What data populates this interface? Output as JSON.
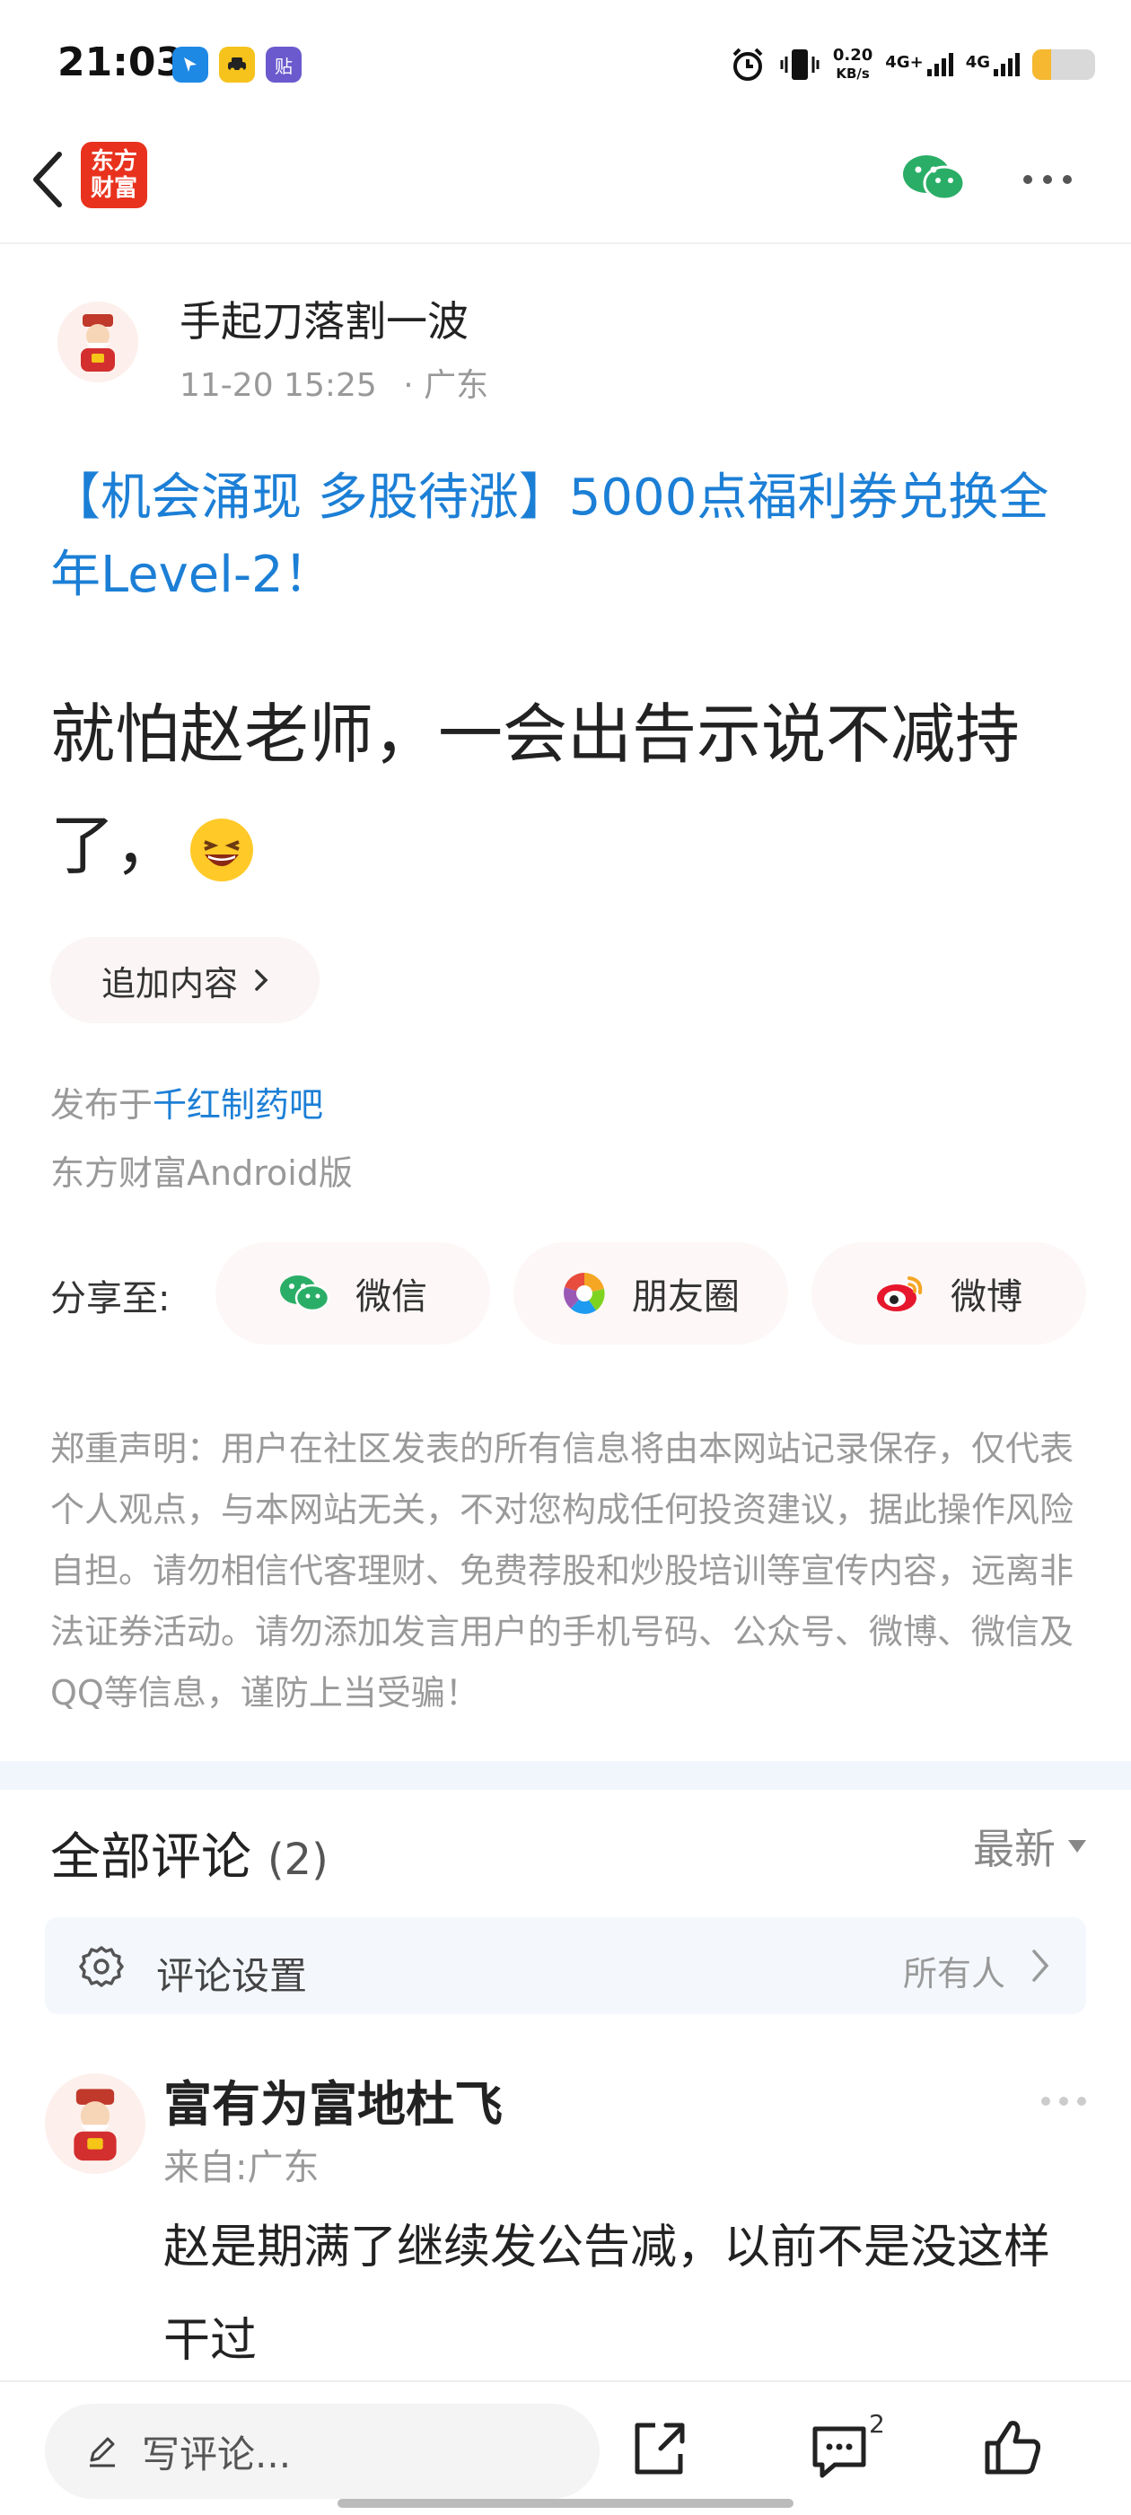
{
  "status_bar": {
    "time": "21:03",
    "speed_value": "0.20",
    "speed_unit": "KB/s",
    "net1": "4G+",
    "net2": "4G",
    "app_icons": [
      "navigation-icon",
      "car-icon",
      "sticker-icon"
    ],
    "sticker_glyph": "贴"
  },
  "nav": {
    "logo_line1": "东方",
    "logo_line2": "财富"
  },
  "post": {
    "author": "手起刀落割一波",
    "date": "11-20 15:25",
    "location": "· 广东",
    "title": "【机会涌现 多股待涨】5000点福利券兑换全年Level-2！",
    "body": "就怕赵老师，一会出告示说不减持了，",
    "append_label": "追加内容",
    "published_prefix": "发布于",
    "published_bar": "千红制药吧",
    "client": "东方财富Android版"
  },
  "share": {
    "label": "分享至:",
    "wechat": "微信",
    "moments": "朋友圈",
    "weibo": "微博"
  },
  "disclaimer": "郑重声明：用户在社区发表的所有信息将由本网站记录保存，仅代表个人观点，与本网站无关，不对您构成任何投资建议，据此操作风险自担。请勿相信代客理财、免费荐股和炒股培训等宣传内容，远离非法证券活动。请勿添加发言用户的手机号码、公众号、微博、微信及QQ等信息，谨防上当受骗！",
  "comments": {
    "title": "全部评论",
    "count": "(2)",
    "sort": "最新",
    "settings_label": "评论设置",
    "settings_value": "所有人",
    "items": [
      {
        "name": "富有为富地杜飞",
        "from": "来自:广东",
        "text": "赵是期满了继续发公告减，以前不是没这样干过"
      }
    ]
  },
  "bottom_bar": {
    "placeholder": "写评论...",
    "comment_badge": "2"
  },
  "colors": {
    "link_blue": "#1c7fd6",
    "brand_red": "#e8321d",
    "wechat_green": "#2aae67",
    "weibo_red": "#e6162d"
  }
}
